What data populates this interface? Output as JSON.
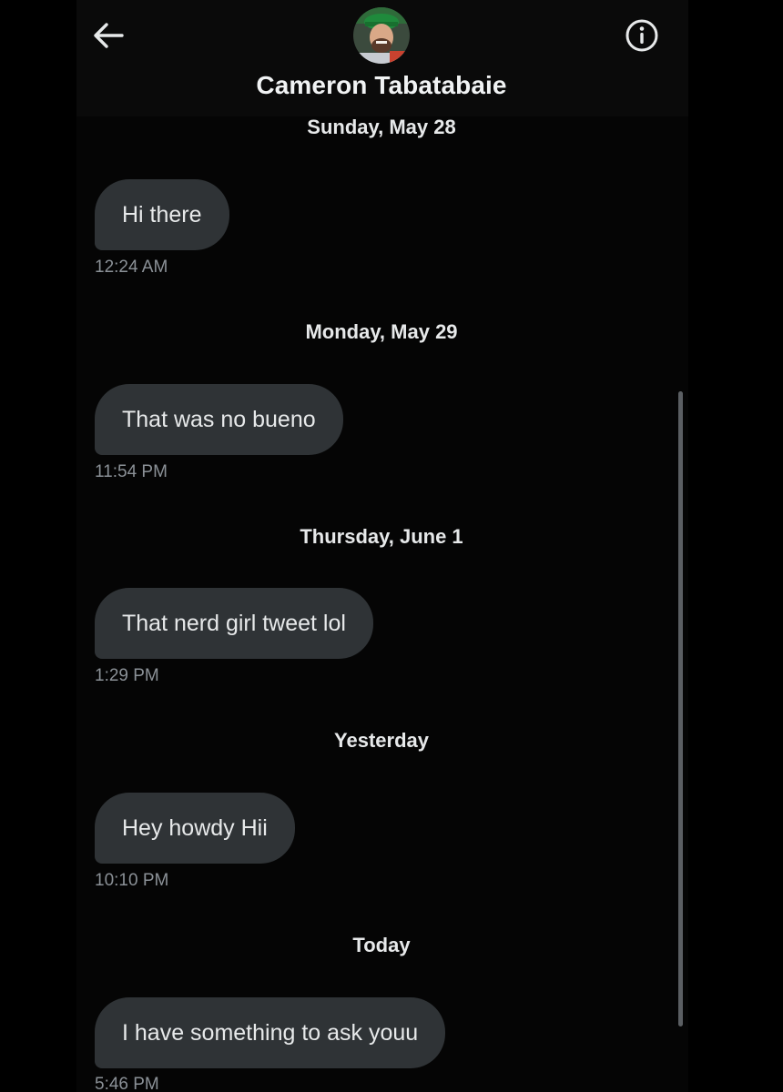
{
  "header": {
    "contact_name": "Cameron Tabatabaie",
    "back_icon": "arrow-left-icon",
    "info_icon": "info-circle-icon"
  },
  "conversation": [
    {
      "day": "Sunday, May 28",
      "message": "Hi there",
      "time": "12:24 AM"
    },
    {
      "day": "Monday, May 29",
      "message": "That was no bueno",
      "time": "11:54 PM"
    },
    {
      "day": "Thursday, June 1",
      "message": "That nerd girl tweet lol",
      "time": "1:29 PM"
    },
    {
      "day": "Yesterday",
      "message": "Hey howdy Hii",
      "time": "10:10 PM"
    },
    {
      "day": "Today",
      "message": "I have something to ask youu",
      "time": "5:46 PM"
    }
  ],
  "colors": {
    "background": "#000000",
    "bubble": "#2f3336",
    "text": "#e7e9ea",
    "timestamp": "#8b9197"
  }
}
